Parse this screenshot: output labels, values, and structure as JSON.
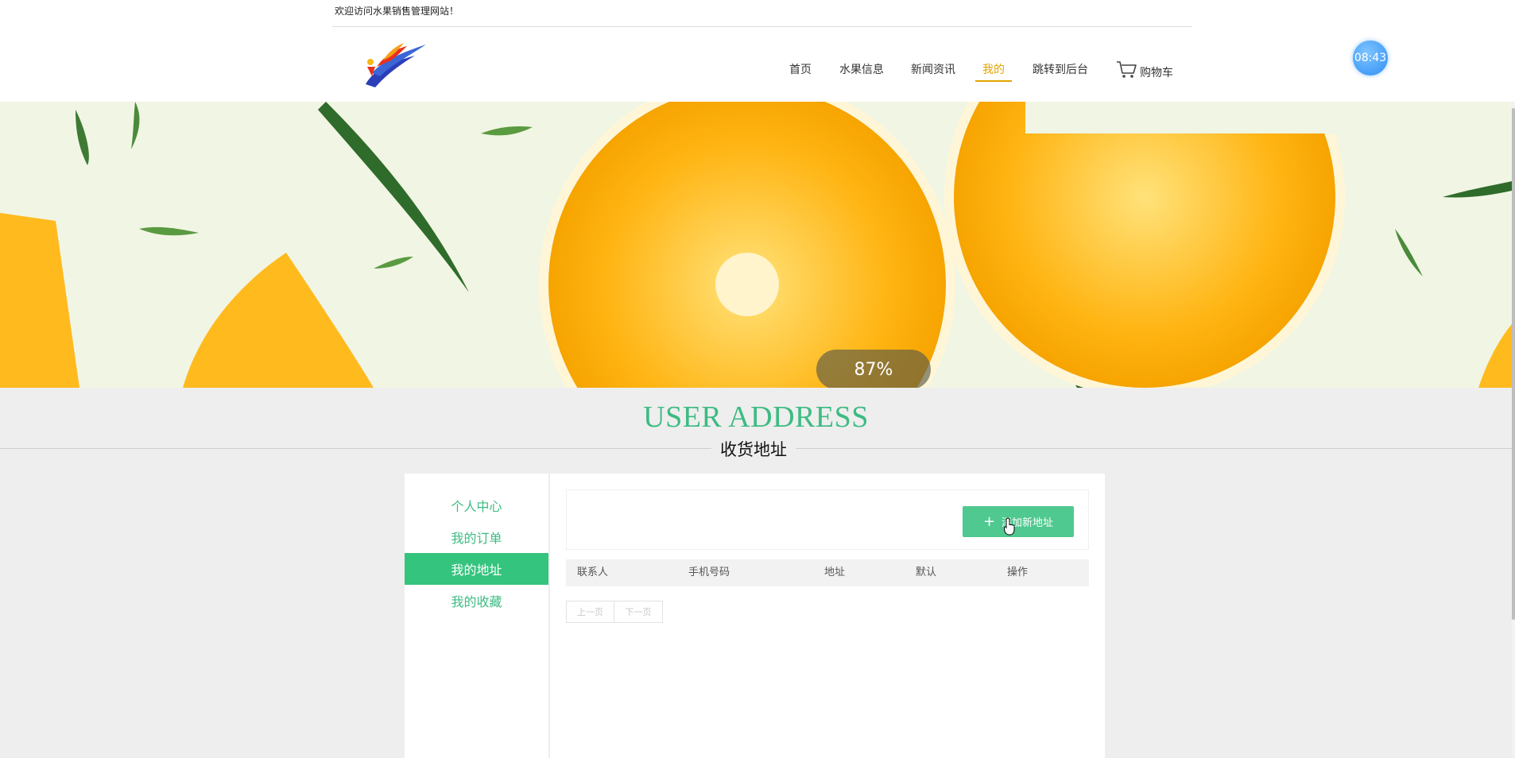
{
  "header": {
    "welcome": "欢迎访问水果销售管理网站！",
    "nav": [
      {
        "label": "首页",
        "active": false
      },
      {
        "label": "水果信息",
        "active": false
      },
      {
        "label": "新闻资讯",
        "active": false
      },
      {
        "label": "我的",
        "active": true
      },
      {
        "label": "跳转到后台",
        "active": false
      }
    ],
    "cart_label": "购物车",
    "clock": "08:43",
    "active_color": "#e2a400"
  },
  "banner": {
    "progress_label": "87%"
  },
  "section": {
    "title": "USER ADDRESS",
    "subtitle": "收货地址",
    "accent_color": "#3dbb82"
  },
  "sidebar": {
    "items": [
      {
        "label": "个人中心",
        "active": false
      },
      {
        "label": "我的订单",
        "active": false
      },
      {
        "label": "我的地址",
        "active": true
      },
      {
        "label": "我的收藏",
        "active": false
      }
    ]
  },
  "main": {
    "add_button": "添加新地址",
    "columns": [
      "联系人",
      "手机号码",
      "地址",
      "默认",
      "操作"
    ],
    "pager": {
      "prev": "上一页",
      "next": "下一页"
    }
  }
}
